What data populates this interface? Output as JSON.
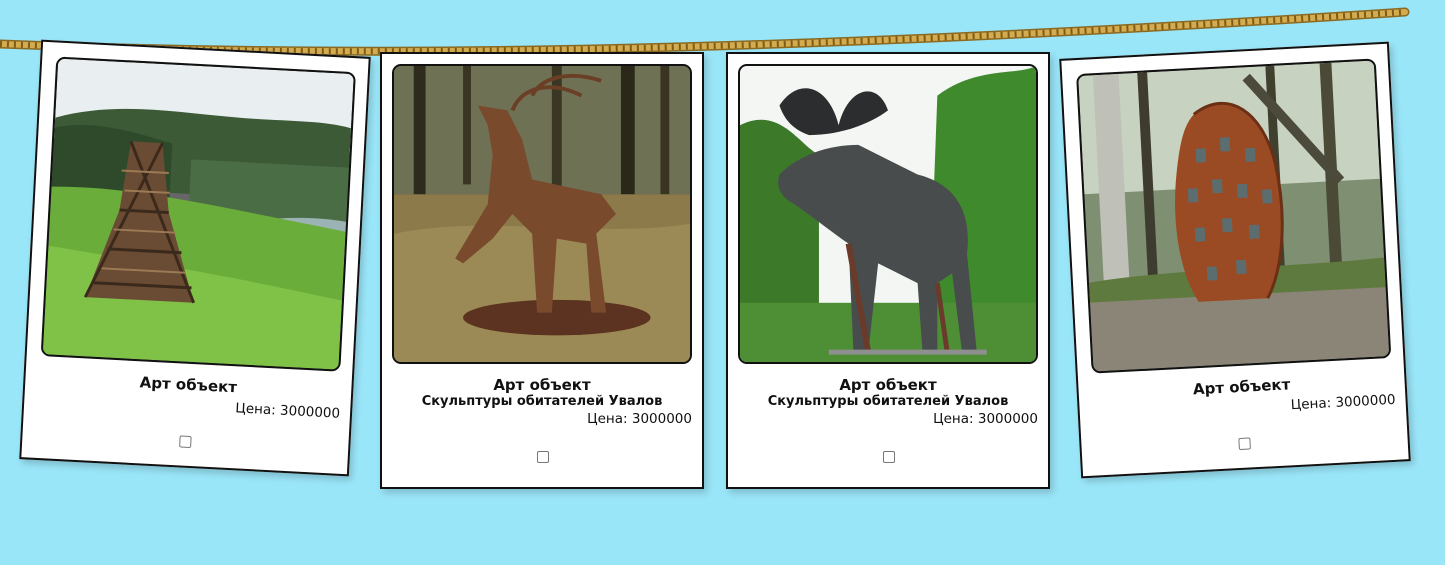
{
  "colors": {
    "background": "#9ae6f9",
    "rope": "#c9a046",
    "card_border": "#111111"
  },
  "cards": [
    {
      "title": "Арт объект",
      "subtitle": "",
      "price_label": "Цена: 3000000",
      "image": "wicker-tower-meadow",
      "checked": false
    },
    {
      "title": "Арт объект",
      "subtitle": "Скульптуры обитателей Увалов",
      "price_label": "Цена: 3000000",
      "image": "bronze-deer-forest",
      "checked": false
    },
    {
      "title": "Арт объект",
      "subtitle": "Скульптуры обитателей Увалов",
      "price_label": "Цена: 3000000",
      "image": "moose-sculpture",
      "checked": false
    },
    {
      "title": "Арт объект",
      "subtitle": "",
      "price_label": "Цена: 3000000",
      "image": "wooden-cone-forest",
      "checked": false
    }
  ]
}
